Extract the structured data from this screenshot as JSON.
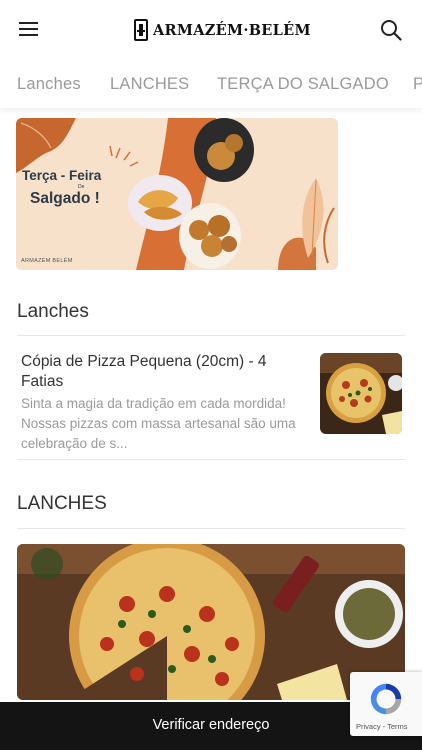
{
  "header": {
    "brand": "ARMAZÉM·BELÉM",
    "menu_icon": "hamburger-menu-icon",
    "search_icon": "search-icon"
  },
  "tabs": [
    {
      "label": "Lanches"
    },
    {
      "label": "LANCHES"
    },
    {
      "label": "TERÇA DO SALGADO"
    },
    {
      "label": "P"
    }
  ],
  "banner": {
    "line1": "Terça - Feira",
    "de": "De",
    "line2": "Salgado !",
    "brand": "ARMAZÉM BELÉM"
  },
  "sections": [
    {
      "title": "Lanches",
      "items": [
        {
          "name": "Cópia de Pizza Pequena (20cm) - 4 Fatias",
          "description": "Sinta a magia da tradição em cada mordida! Nossas pizzas com massa artesanal são uma celebração de s..."
        }
      ]
    },
    {
      "title": "LANCHES"
    }
  ],
  "bottom_bar": {
    "label": "Verificar endereço"
  },
  "recaptcha": {
    "terms": "Privacy - Terms",
    "icon": "recaptcha-icon"
  },
  "colors": {
    "accent_dark": "#141414",
    "muted_text": "#9a9a9a",
    "banner_orange": "#c9652f"
  }
}
